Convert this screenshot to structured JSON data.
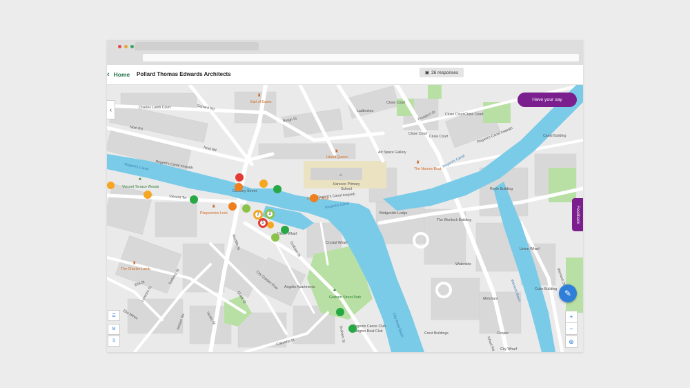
{
  "header": {
    "home_label": "Home",
    "project_title": "Pollard Thomas Edwards Architects",
    "responses_label": "26 responses"
  },
  "map": {
    "have_your_say_label": "Have your say",
    "feedback_label": "Feedback",
    "zoom_in": "+",
    "zoom_out": "−",
    "layer_m": "M",
    "layer_s": "S",
    "clusters": [
      "2",
      "2",
      "5"
    ],
    "labels": {
      "charles_lamb_court": "Charles Lamb Court",
      "earl_of_essex": "Earl of Essex",
      "gerrard_rd": "Gerrard Rd",
      "burgh_st": "Burgh St",
      "ladbrokes": "Ladbrokes",
      "cluse_court_1": "Cluse Court",
      "cluse_court_2": "Cluse Court",
      "cluse_court_3": "Cluse Court",
      "cluse_court_4": "Cluse Court",
      "cluse_court_5": "Cluse Court",
      "prospect_st": "Prospect St",
      "noel_rd_1": "Noel Rd",
      "noel_rd_2": "Noel Rd",
      "art_space_gallery": "Art Space Gallery",
      "island_queen": "Island Queen",
      "regents_canal_towpath_1": "Regent's Canal towpath",
      "regents_canal_towpath_2": "Regent's Canal towpath",
      "regents_canal_towpath_3": "Regent's Canal towpath",
      "regents_canal_1": "Regent's Canal",
      "regents_canal_2": "Regent's Canal",
      "regents_canal_3": "Regent's Canal",
      "hanover_school": "Hanover Primary School",
      "narrow_boat": "The Narrow Boat",
      "royle_building": "Royle Building",
      "canal_building": "Canal Building",
      "vincent_terrace_woods": "Vincent Terrace Woods",
      "vincent_ter": "Vincent Ter",
      "danbury_street": "Danbury Street",
      "plaquemine_lock": "Plaquemine Lock",
      "islington_boat": "Islington Boat",
      "dixon_wharf": "Dixon Wharf",
      "bridgeside_lodge": "Bridgeside Lodge",
      "wenlock_building": "The Wenlock Building",
      "union_wharf": "Union Wharf",
      "crystal_wharf": "Crystal Wharf",
      "waterside": "Waterside",
      "the_charles_lamb": "The Charles Lamb",
      "elia_st": "Elia St",
      "sudeley_st": "Sudeley St",
      "rocliffe_st": "Rocliffe St",
      "graham_st_1": "Graham St",
      "graham_st_2": "Graham St",
      "city_garden_row": "City Garden Row",
      "angelis_apartments": "Angelis Apartments",
      "graham_street_park": "Graham Street Park",
      "wenlock_basin": "Wenlock Basin",
      "city_road_basin": "City Road Basin",
      "cubo_building": "Cubo Building",
      "merchant": "Merchant",
      "cooper": "Cooper",
      "wharf_rd": "Wharf Rd",
      "city_wharf": "City Wharf",
      "crest_buildings": "Crest Buildings",
      "wenlock_st": "Wenlock St",
      "regents_canoe_club": "Regents Canoe Club",
      "islington_boat_club": "Islington Boat Club",
      "colombo_st": "Colombo St",
      "nelson_ter": "Nelson Ter",
      "elia_mews": "Elia Mews",
      "vestry_st": "Vestry St",
      "quick_st": "Quick St",
      "lorenzo_st": "Lorenzo St"
    }
  },
  "colors": {
    "brand_green": "#1f6f45",
    "purple": "#7b1f8f",
    "water": "#79cbe8",
    "park": "#b8e0a4",
    "red_pin": "#e53935",
    "orange_pin": "#f07f1d",
    "yellow_pin": "#f5a623",
    "green_pin": "#27a844",
    "lime_pin": "#8bc34a"
  }
}
